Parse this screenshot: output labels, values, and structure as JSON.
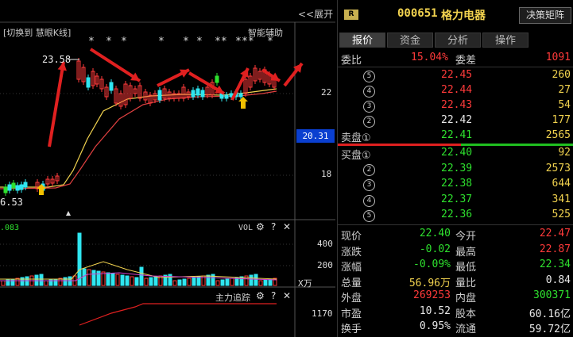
{
  "chart": {
    "switch_label": "[切换到 慧眼K线]",
    "assist_label": "智能辅助",
    "expand_label": "<<展开",
    "high_label": "23.58",
    "low_label": "6.53",
    "current_price_tag": "20.31",
    "y_ticks": [
      "22",
      "18"
    ],
    "stars": [
      "*",
      "*",
      "*",
      "*",
      "*",
      "*",
      "**",
      "*",
      "**",
      "*"
    ],
    "vol": {
      "label": "VOL",
      "left_value": ".083",
      "ticks": [
        "400",
        "200"
      ],
      "unit": "X万"
    },
    "main_track": {
      "label": "主力追踪",
      "tick": "1170"
    }
  },
  "quote": {
    "badge": "R",
    "code": "000651",
    "name": "格力电器",
    "decision_button": "决策矩阵",
    "tabs": [
      "报价",
      "资金",
      "分析",
      "操作"
    ],
    "weibi_label": "委比",
    "weibi_value": "15.04%",
    "weicha_label": "委差",
    "weicha_value": "1091",
    "sell_label": "卖盘①",
    "buy_label": "买盘①",
    "asks": [
      {
        "n": "5",
        "price": "22.45",
        "vol": "260"
      },
      {
        "n": "4",
        "price": "22.44",
        "vol": "27"
      },
      {
        "n": "3",
        "price": "22.43",
        "vol": "54"
      },
      {
        "n": "2",
        "price": "22.42",
        "vol": "177"
      },
      {
        "n": "1",
        "price": "22.41",
        "vol": "2565"
      }
    ],
    "bids": [
      {
        "n": "1",
        "price": "22.40",
        "vol": "92"
      },
      {
        "n": "2",
        "price": "22.39",
        "vol": "2573"
      },
      {
        "n": "3",
        "price": "22.38",
        "vol": "644"
      },
      {
        "n": "4",
        "price": "22.37",
        "vol": "341"
      },
      {
        "n": "5",
        "price": "22.36",
        "vol": "525"
      }
    ],
    "stats": [
      {
        "l1": "现价",
        "v1": "22.40",
        "c1": "green",
        "l2": "今开",
        "v2": "22.47",
        "c2": "red"
      },
      {
        "l1": "涨跌",
        "v1": "-0.02",
        "c1": "green",
        "l2": "最高",
        "v2": "22.87",
        "c2": "red"
      },
      {
        "l1": "涨幅",
        "v1": "-0.09%",
        "c1": "green",
        "l2": "最低",
        "v2": "22.34",
        "c2": "green"
      },
      {
        "l1": "总量",
        "v1": "56.96万",
        "c1": "yellow",
        "l2": "量比",
        "v2": "0.84",
        "c2": "white"
      },
      {
        "l1": "外盘",
        "v1": "269253",
        "c1": "red",
        "l2": "内盘",
        "v2": "300371",
        "c2": "green"
      },
      {
        "l1": "市盈",
        "v1": "10.52",
        "c1": "white",
        "l2": "股本",
        "v2": "60.16亿",
        "c2": "white"
      },
      {
        "l1": "换手",
        "v1": "0.95%",
        "c1": "white",
        "l2": "流通",
        "v2": "59.72亿",
        "c2": "white"
      }
    ],
    "colors": {
      "up": "#ff3a3a",
      "down": "#2ee02e",
      "accent": "#f2d34f",
      "price_tag": "#0a3fd0"
    }
  }
}
